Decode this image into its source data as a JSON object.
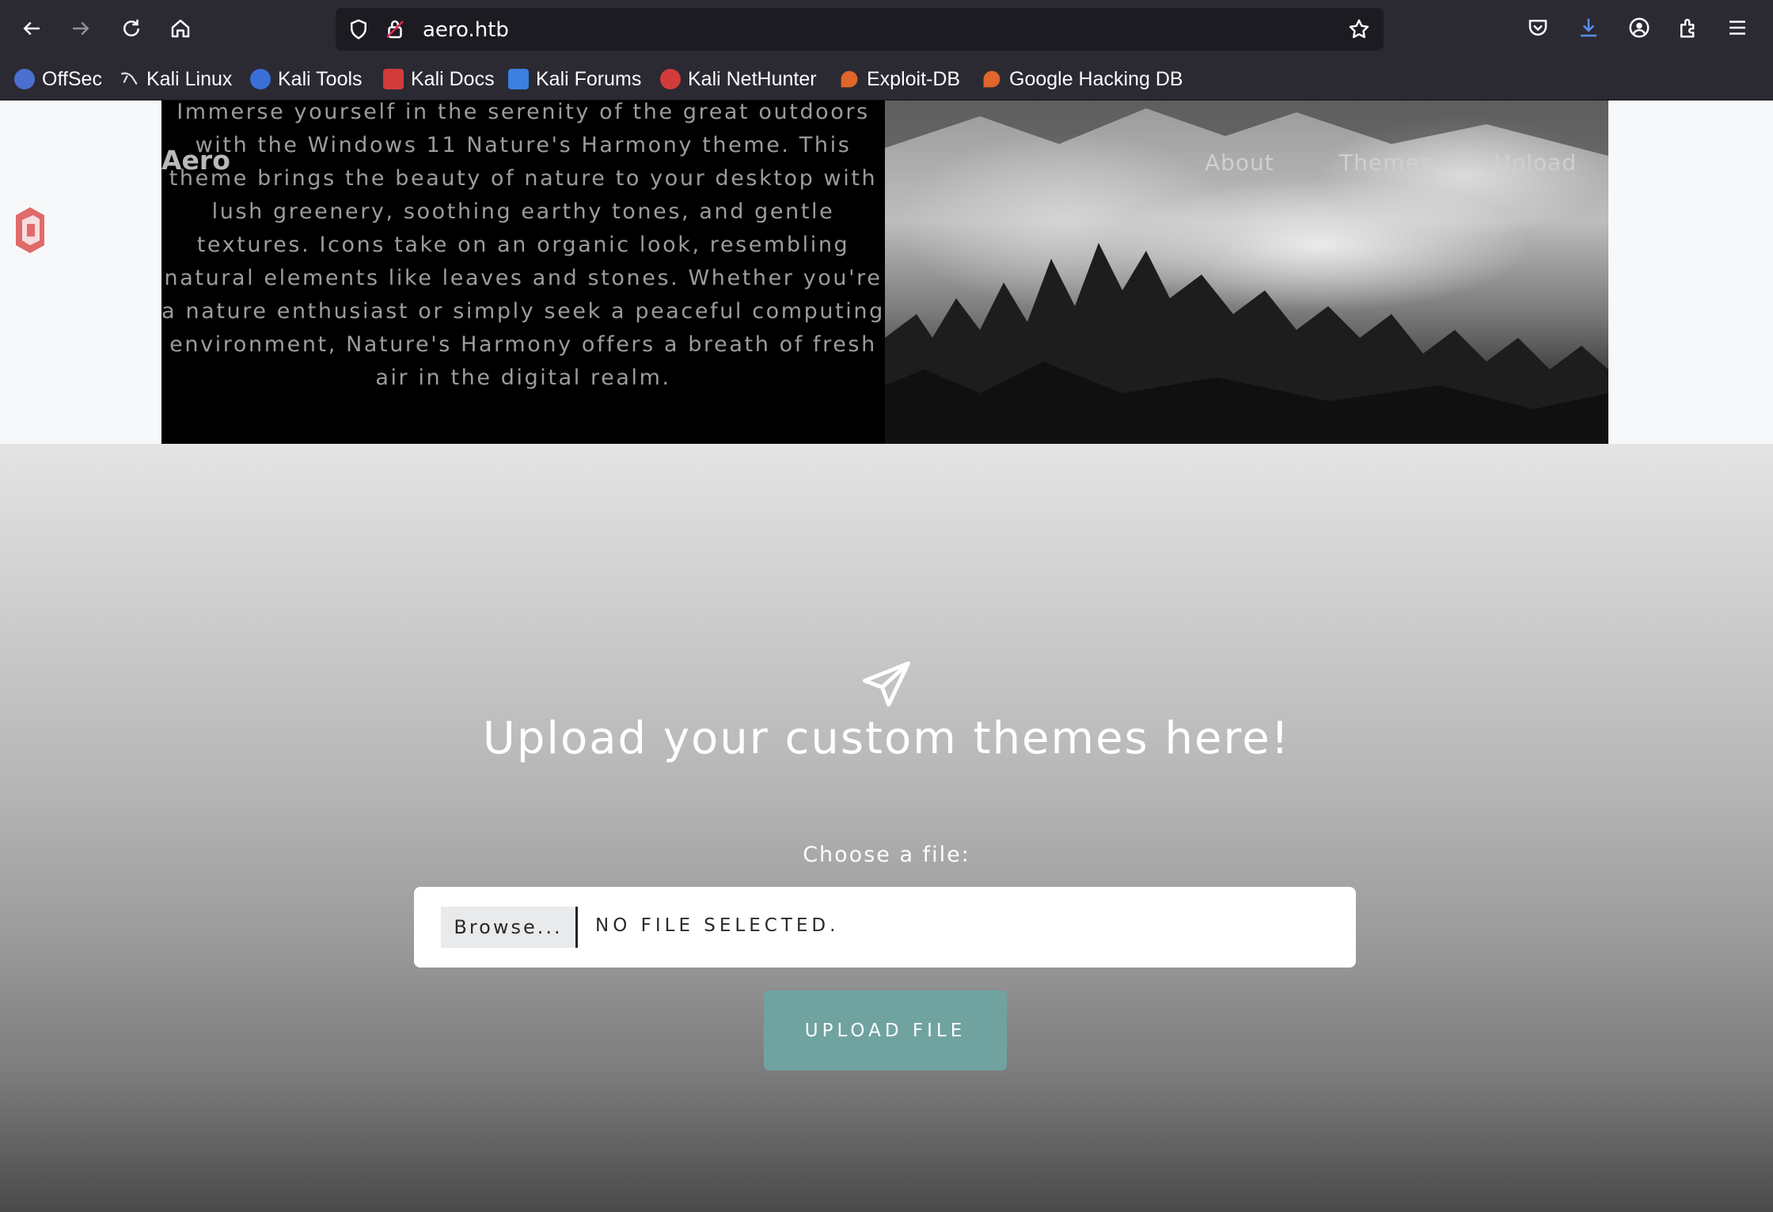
{
  "browser": {
    "url": "aero.htb",
    "nav_icons": [
      "back-icon",
      "forward-icon",
      "reload-icon",
      "home-icon"
    ],
    "toolbar_icons": [
      "pocket-icon",
      "downloads-icon",
      "account-icon",
      "extensions-icon",
      "menu-icon"
    ],
    "bookmarks": [
      {
        "label": "OffSec",
        "icon": "offsec-icon",
        "color": "#4a6fd0"
      },
      {
        "label": "Kali Linux",
        "icon": "kali-dragon-icon",
        "color": "#2b2a33"
      },
      {
        "label": "Kali Tools",
        "icon": "kali-tools-icon",
        "color": "#3b6fd8"
      },
      {
        "label": "Kali Docs",
        "icon": "kali-docs-icon",
        "color": "#d23b3b"
      },
      {
        "label": "Kali Forums",
        "icon": "kali-forums-icon",
        "color": "#3b7fe0"
      },
      {
        "label": "Kali NetHunter",
        "icon": "kali-nethunter-icon",
        "color": "#d23b3b"
      },
      {
        "label": "Exploit-DB",
        "icon": "exploit-db-icon",
        "color": "#e0662b"
      },
      {
        "label": "Google Hacking DB",
        "icon": "ghdb-icon",
        "color": "#e0662b"
      }
    ]
  },
  "site": {
    "brand": "Aero",
    "nav": [
      "About",
      "Themes",
      "Upload"
    ],
    "hero_text": "Immerse yourself in the serenity of the great outdoors with the Windows 11 Nature's Harmony theme. This theme brings the beauty of nature to your desktop with lush greenery, soothing earthy tones, and gentle textures. Icons take on an organic look, resembling natural elements like leaves and stones. Whether you're a nature enthusiast or simply seek a peaceful computing environment, Nature's Harmony offers a breath of fresh air in the digital realm."
  },
  "upload": {
    "icon": "paper-plane-icon",
    "title": "Upload your custom themes here!",
    "choose_label": "Choose a file:",
    "browse_label": "Browse...",
    "no_file_label": "NO FILE SELECTED.",
    "submit_label": "UPLOAD FILE",
    "accent": "#70a3a0"
  }
}
